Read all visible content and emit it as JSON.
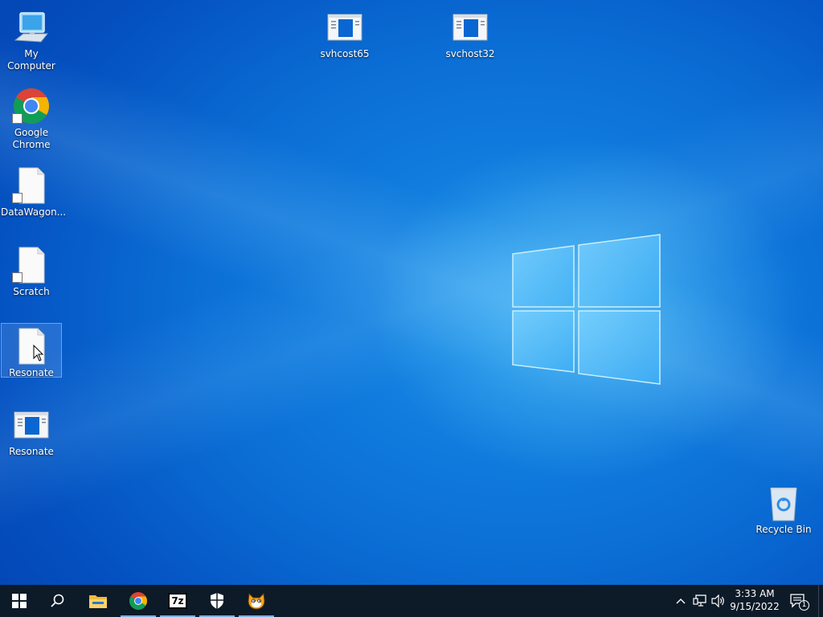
{
  "desktop": {
    "icons": [
      {
        "label": "My Computer"
      },
      {
        "label": "svhcost65"
      },
      {
        "label": "svchost32"
      },
      {
        "label": "Google Chrome"
      },
      {
        "label": "DataWagon..."
      },
      {
        "label": "Scratch"
      },
      {
        "label": "Resonate"
      },
      {
        "label": "Resonate"
      },
      {
        "label": "Recycle Bin"
      }
    ]
  },
  "taskbar": {
    "pinned": [
      {
        "icon": "windows-start-icon"
      },
      {
        "icon": "search-icon"
      },
      {
        "icon": "file-explorer-icon"
      },
      {
        "icon": "chrome-icon"
      },
      {
        "icon": "7zip-icon",
        "text": "7z"
      },
      {
        "icon": "shield-icon"
      },
      {
        "icon": "scratch-cat-icon"
      }
    ],
    "clock": {
      "time": "3:33 AM",
      "date": "9/15/2022"
    },
    "notifications": {
      "count": "1"
    }
  },
  "colors": {
    "taskbar": "#0d1a28",
    "desktop_accent": "#0b6fd6"
  }
}
